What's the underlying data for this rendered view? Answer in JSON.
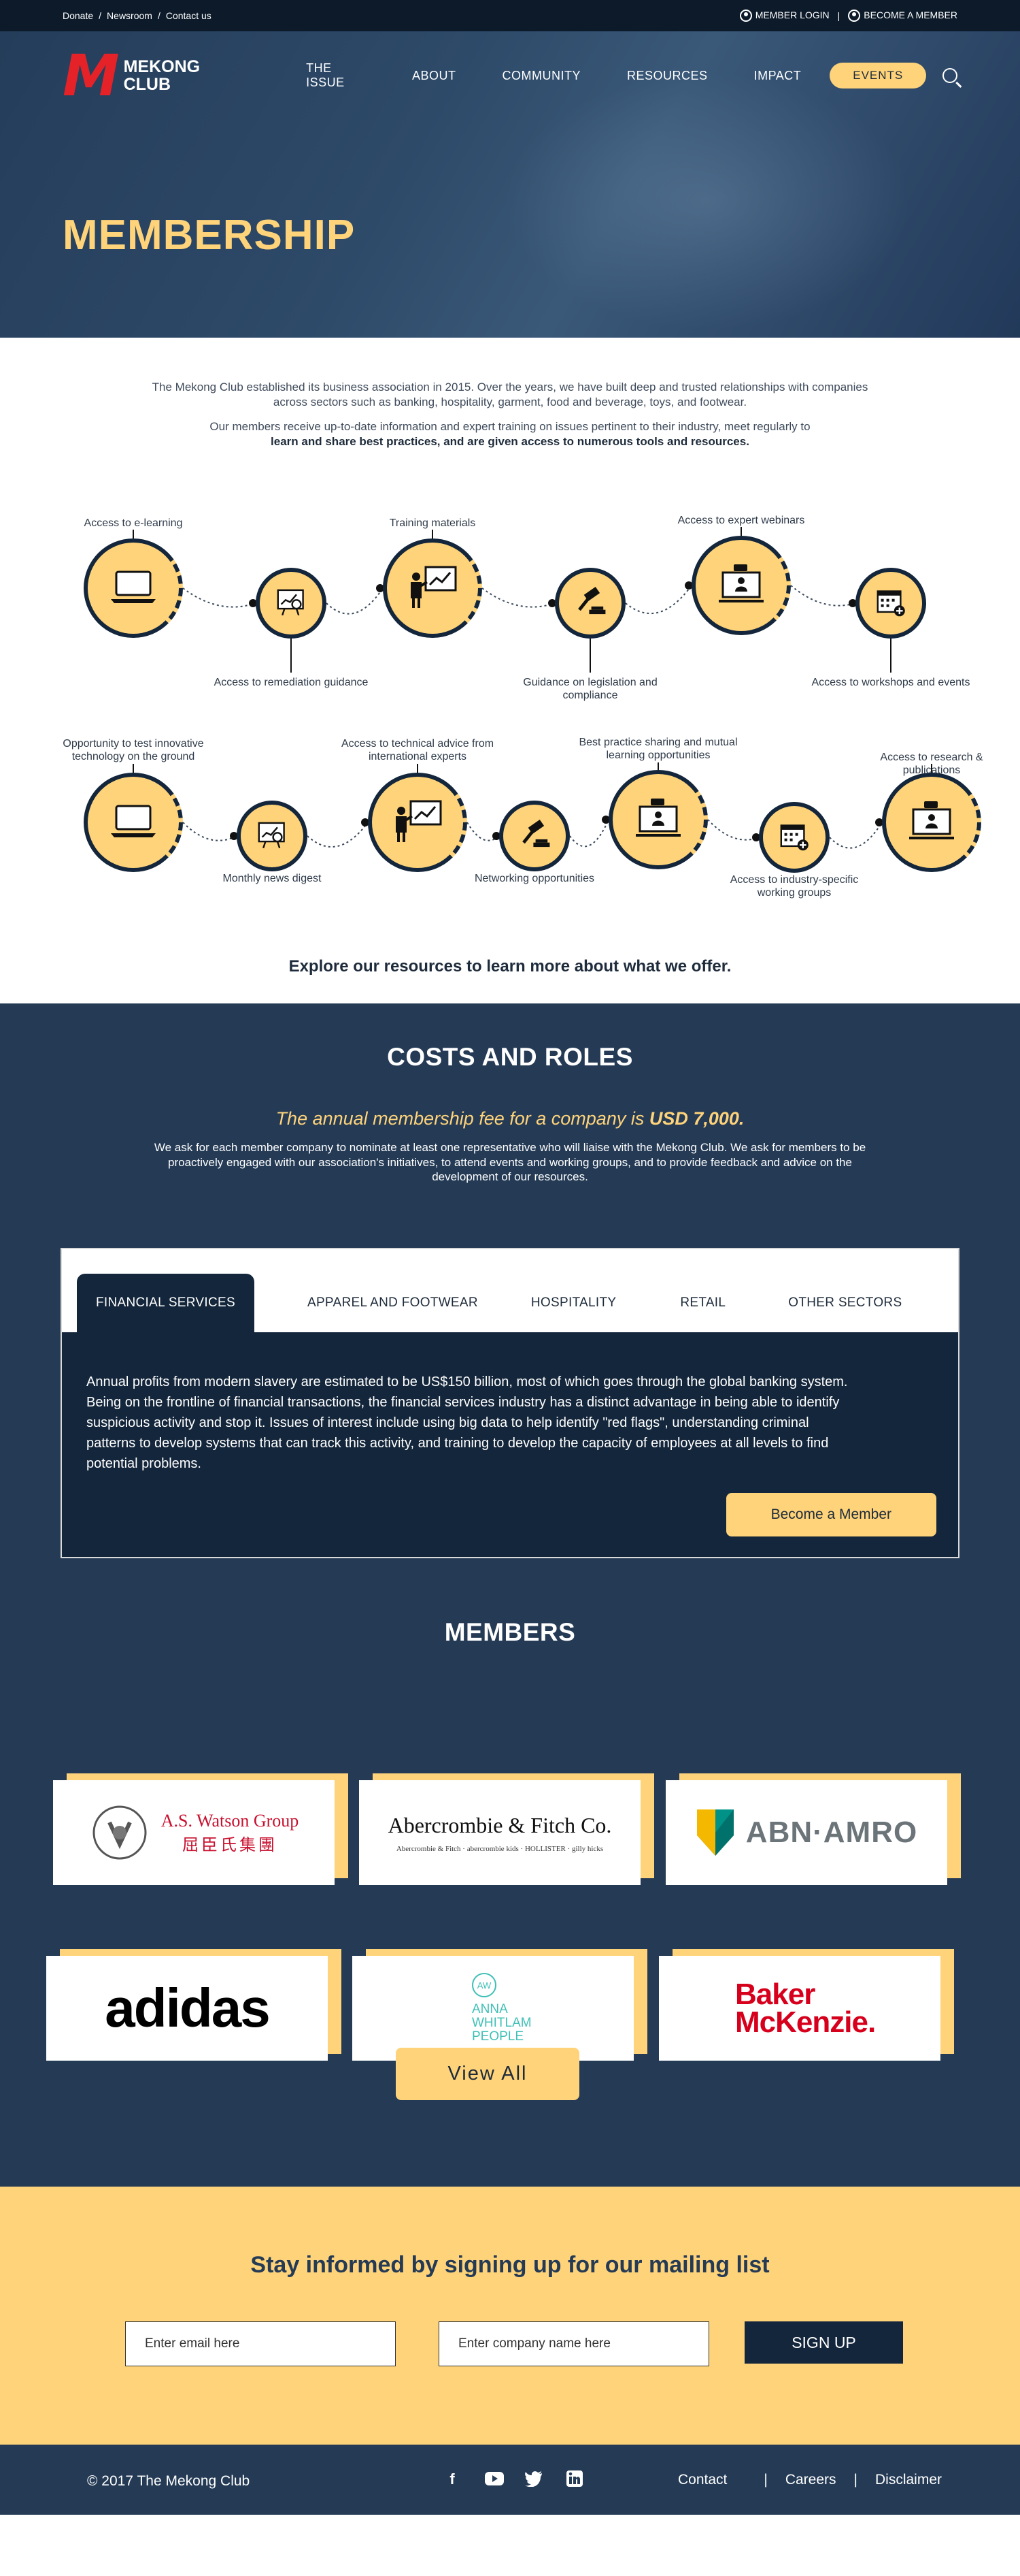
{
  "topbar": {
    "links": [
      "Donate",
      "Newsroom",
      "Contact us"
    ],
    "separator": "/",
    "login": "MEMBER LOGIN",
    "divider": "|",
    "become": "BECOME A MEMBER"
  },
  "nav": {
    "logo_letter": "M",
    "logo_line1": "MEKONG",
    "logo_line2": "CLUB",
    "items": [
      "THE ISSUE",
      "ABOUT",
      "COMMUNITY",
      "RESOURCES",
      "IMPACT"
    ],
    "events": "EVENTS"
  },
  "hero": {
    "title": "MEMBERSHIP"
  },
  "intro": {
    "p1": "The Mekong Club established its business association in 2015. Over the years, we have built deep and trusted relationships with companies across sectors such as banking, hospitality, garment, food and beverage, toys, and footwear.",
    "p2_start": "Our members receive up-to-date information and expert training on issues pertinent to their industry, meet regularly to",
    "p2_bold": "learn and share best practices, and are given access to numerous tools and resources."
  },
  "benefits": [
    {
      "label": "Access to  e-learning",
      "icon": "laptop-icon"
    },
    {
      "label": "Access to remediation guidance",
      "icon": "chart-board-icon"
    },
    {
      "label": "Training materials",
      "icon": "presenter-icon"
    },
    {
      "label": "Guidance on legislation and compliance",
      "icon": "gavel-icon"
    },
    {
      "label": "Access to expert webinars",
      "icon": "webinar-icon"
    },
    {
      "label": "Access to workshops and events",
      "icon": "calendar-icon"
    },
    {
      "label": "Opportunity to test innovative technology on the ground",
      "icon": "laptop-icon"
    },
    {
      "label": "Monthly news digest",
      "icon": "chart-board-icon"
    },
    {
      "label": "Access to technical advice from international experts",
      "icon": "presenter-icon"
    },
    {
      "label": "Networking opportunities",
      "icon": "gavel-icon"
    },
    {
      "label": "Best practice sharing and mutual learning opportunities",
      "icon": "webinar-icon"
    },
    {
      "label": "Access to industry-specific working groups",
      "icon": "calendar-icon"
    },
    {
      "label": "Access to research & publications",
      "icon": "webinar-icon"
    }
  ],
  "explore": "Explore our resources to learn more about what we offer.",
  "costs": {
    "title": "COSTS AND ROLES",
    "fee_prefix": "The annual membership fee for a company is",
    "fee_amount": "USD 7,000.",
    "description": "We ask for each member company to nominate at least one representative who will liaise with the Mekong Club. We ask for members to be proactively engaged with our association's initiatives, to attend events and working groups, and to provide feedback and advice on the development of our resources.",
    "tabs": [
      "FINANCIAL SERVICES",
      "APPAREL  AND  FOOTWEAR",
      "HOSPITALITY",
      "RETAIL",
      "OTHER SECTORS"
    ],
    "active_tab": "FINANCIAL SERVICES",
    "panel_text": "Annual profits from modern slavery are estimated to be US$150 billion, most of which goes through the global banking system. Being on the frontline of financial transactions, the financial services industry has a distinct advantage in being able to identify suspicious activity and stop it. Issues of interest include using big data to help identify \"red flags\", understanding criminal patterns to develop systems that can track this activity, and training to develop the capacity of employees at all levels to find potential problems.",
    "become_button": "Become a Member"
  },
  "members": {
    "title": "MEMBERS",
    "logos": [
      {
        "name": "A.S. Watson Group",
        "sub": "屈臣氏集團"
      },
      {
        "name": "Abercrombie & Fitch Co.",
        "sub": "Abercrombie & Fitch  ·  abercrombie kids  ·  HOLLISTER  ·  gilly hicks"
      },
      {
        "name": "ABN·AMRO",
        "sub": ""
      },
      {
        "name": "adidas",
        "sub": ""
      },
      {
        "name": "ANNA WHITLAM PEOPLE",
        "sub": "AW"
      },
      {
        "name": "Baker McKenzie.",
        "sub": ""
      }
    ],
    "view_all": "View All"
  },
  "mailing": {
    "title": "Stay informed by signing up for our mailing list",
    "email_placeholder": "Enter email here",
    "company_placeholder": "Enter  company name here",
    "signup": "SIGN UP"
  },
  "footer": {
    "copyright": "© 2017 The Mekong Club",
    "social": [
      "facebook-icon",
      "youtube-icon",
      "twitter-icon",
      "linkedin-icon"
    ],
    "links": [
      "Contact",
      "Careers",
      "Disclaimer"
    ],
    "divider": "|"
  },
  "colors": {
    "navy": "#243a55",
    "dark_navy": "#14263b",
    "yellow": "#fed37a",
    "red": "#e62229"
  }
}
